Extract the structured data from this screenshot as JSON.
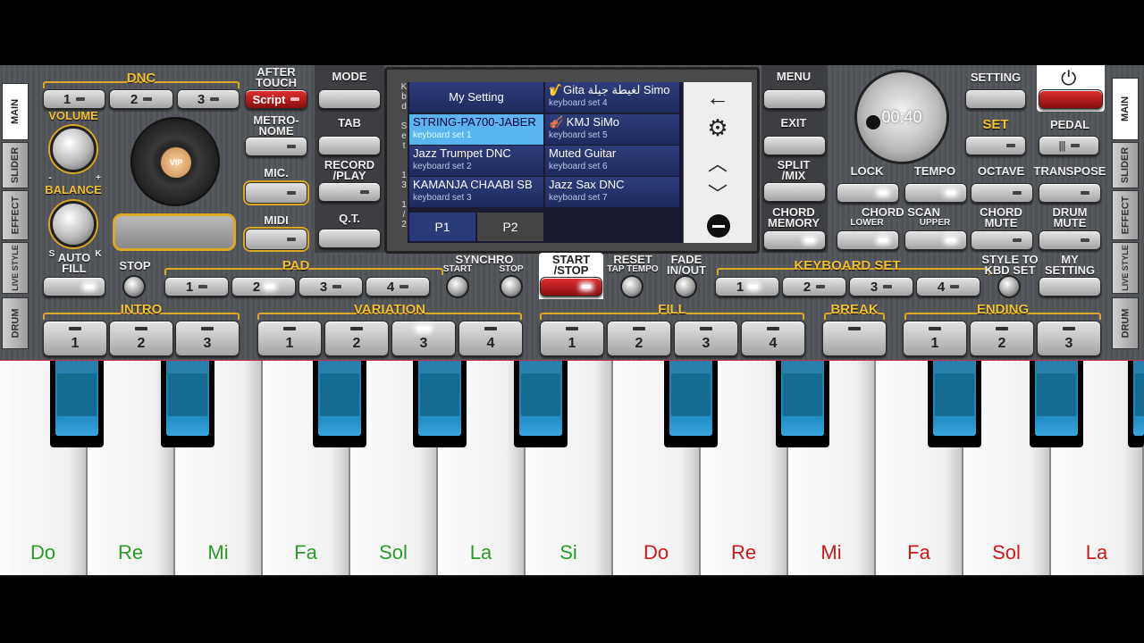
{
  "side_tabs_left": [
    "MAIN",
    "SLIDER",
    "EFFECT",
    "LIVE STYLE",
    "DRUM"
  ],
  "side_tabs_right": [
    "MAIN",
    "SLIDER",
    "EFFECT",
    "LIVE STYLE",
    "DRUM"
  ],
  "dnc": {
    "title": "DNC",
    "buttons": [
      "1",
      "2",
      "3"
    ],
    "script": "Script",
    "after_touch": "AFTER\nTOUCH"
  },
  "labels": {
    "volume": "VOLUME",
    "balance": "BALANCE",
    "bal_minus": "-",
    "bal_plus": "+",
    "s": "S",
    "k": "K",
    "metronome": "METRO-\nNOME",
    "mic": "MIC.",
    "midi": "MIDI",
    "mode": "MODE",
    "tab": "TAB",
    "record": "RECORD\n/PLAY",
    "qt": "Q.T.",
    "menu": "MENU",
    "exit": "EXIT",
    "split": "SPLIT\n/MIX",
    "chord_memory": "CHORD\nMEMORY",
    "setting": "SETTING",
    "set": "SET",
    "pedal": "PEDAL",
    "lock": "LOCK",
    "tempo": "TEMPO",
    "octave": "OCTAVE",
    "transpose": "TRANSPOSE",
    "chord_scan": "CHORD SCAN",
    "lower": "LOWER",
    "upper": "UPPER",
    "chord_mute": "CHORD\nMUTE",
    "drum_mute": "DRUM\nMUTE",
    "auto_fill": "AUTO\nFILL",
    "stop": "STOP",
    "pad": "PAD",
    "synchro": "SYNCHRO",
    "start": "START",
    "synchro_stop": "STOP",
    "start_stop": "START\n/STOP",
    "reset": "RESET",
    "tap_tempo": "TAP TEMPO",
    "fade": "FADE\nIN/OUT",
    "keyboard_set": "KEYBOARD SET",
    "style_to_kbd": "STYLE TO\nKBD SET",
    "my_setting": "MY\nSETTING",
    "intro": "INTRO",
    "variation": "VARIATION",
    "fill": "FILL",
    "break": "BREAK",
    "ending": "ENDING"
  },
  "vip_label": "VIP",
  "timer": "00:40",
  "pad_buttons": [
    "1",
    "2",
    "3",
    "4"
  ],
  "kbd_buttons": [
    "1",
    "2",
    "3",
    "4"
  ],
  "intro_buttons": [
    "1",
    "2",
    "3"
  ],
  "variation_buttons": [
    "1",
    "2",
    "3",
    "4"
  ],
  "fill_buttons": [
    "1",
    "2",
    "3",
    "4"
  ],
  "ending_buttons": [
    "1",
    "2",
    "3"
  ],
  "screen": {
    "kbd_set_vert": "K\nb\nd\n \nS\ne\nt\n \n \n1\n3\n \n1\n/\n2",
    "my_setting": "My Setting",
    "cells": [
      {
        "name": "STRING-PA700-JABER",
        "sub": "keyboard set 1",
        "selected": true
      },
      {
        "name": "Jazz Trumpet DNC",
        "sub": "keyboard set 2",
        "selected": false
      },
      {
        "name": "KAMANJA CHAABI SB",
        "sub": "keyboard set 3",
        "selected": false
      },
      {
        "name": "🎷Gita لغيطة جيلة Simo",
        "sub": "keyboard set 4",
        "selected": false
      },
      {
        "name": "🎻 KMJ SiMo",
        "sub": "keyboard set 5",
        "selected": false
      },
      {
        "name": "Muted Guitar",
        "sub": "keyboard set 6",
        "selected": false
      },
      {
        "name": "Jazz Sax DNC",
        "sub": "keyboard set 7",
        "selected": false
      }
    ],
    "pages": [
      "P1",
      "P2"
    ]
  },
  "white_keys": [
    {
      "label": "Do",
      "color": "#2a9a2a"
    },
    {
      "label": "Re",
      "color": "#2a9a2a"
    },
    {
      "label": "Mi",
      "color": "#2a9a2a"
    },
    {
      "label": "Fa",
      "color": "#2a9a2a"
    },
    {
      "label": "Sol",
      "color": "#2a9a2a"
    },
    {
      "label": "La",
      "color": "#2a9a2a"
    },
    {
      "label": "Si",
      "color": "#2a9a2a"
    },
    {
      "label": "Do",
      "color": "#cc1a1a"
    },
    {
      "label": "Re",
      "color": "#cc1a1a"
    },
    {
      "label": "Mi",
      "color": "#cc1a1a"
    },
    {
      "label": "Fa",
      "color": "#cc1a1a"
    },
    {
      "label": "Sol",
      "color": "#cc1a1a"
    },
    {
      "label": "La",
      "color": "#cc1a1a"
    }
  ],
  "colors": {
    "gold": "#d9a925",
    "selected_cell": "#5ab4f0",
    "red_button": "#c01a1a"
  }
}
